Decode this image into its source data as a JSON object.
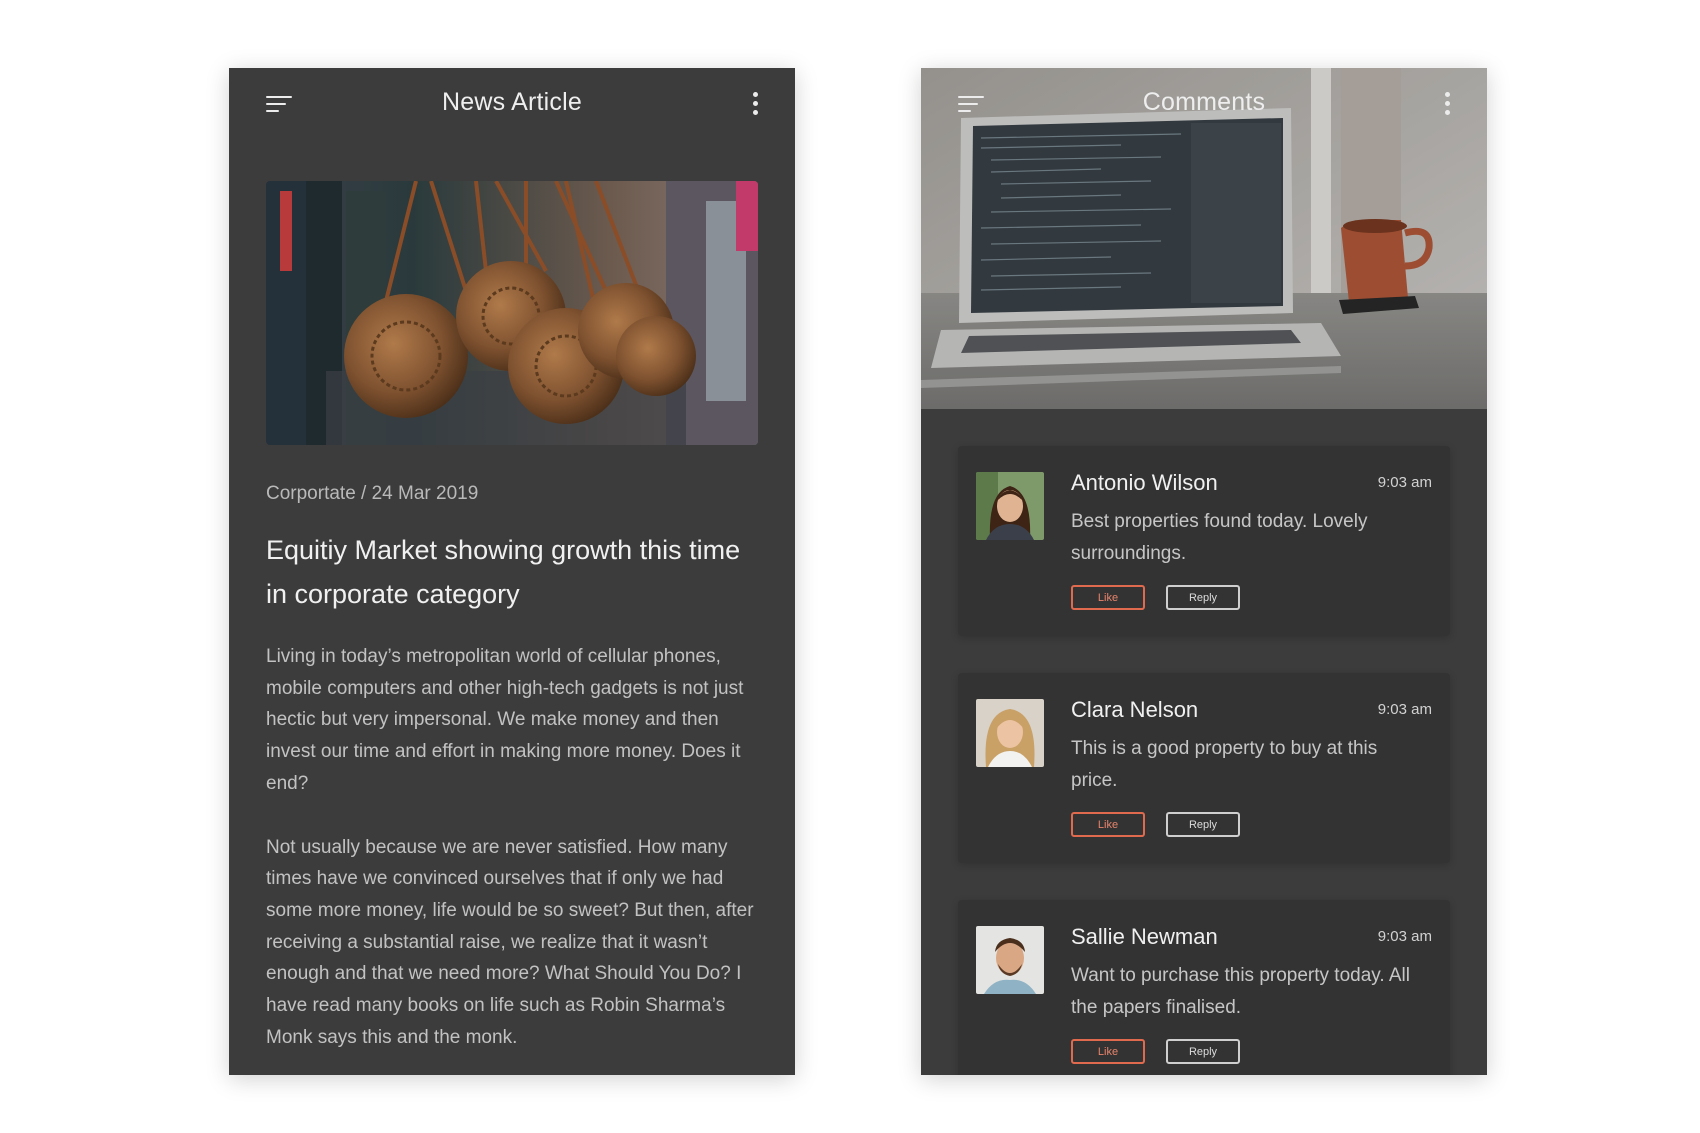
{
  "article_screen": {
    "header": {
      "title": "News Article",
      "menu_icon": "hamburger-menu-icon",
      "more_icon": "kebab-more-icon"
    },
    "hero_image": "photo-woven-rattan-bags",
    "meta": "Corportate / 24 Mar 2019",
    "title": "Equitiy Market showing growth this time in corporate category",
    "paragraphs": [
      "Living in today’s metropolitan world of cellular phones, mobile computers and other high-tech gadgets is not just hectic but very impersonal. We make money and then invest our time and effort in making more money. Does it end?",
      "Not usually because we are never satisfied. How many times have we convinced ourselves that if only we had some more money, life would be so sweet? But then, after receiving a substantial raise, we realize that it wasn’t enough and that we need more? What Should You Do? I have read many books on life such as Robin Sharma’s Monk says this and the monk."
    ]
  },
  "comments_screen": {
    "header": {
      "title": "Comments",
      "menu_icon": "hamburger-menu-icon",
      "more_icon": "kebab-more-icon"
    },
    "cover_image": "photo-laptop-and-coffee-mug",
    "comments": [
      {
        "name": "Antonio Wilson",
        "time": "9:03 am",
        "text": "Best properties found today. Lovely surroundings.",
        "like_label": "Like",
        "reply_label": "Reply"
      },
      {
        "name": "Clara Nelson",
        "time": "9:03 am",
        "text": "This is a good property to buy at this price.",
        "like_label": "Like",
        "reply_label": "Reply"
      },
      {
        "name": "Sallie Newman",
        "time": "9:03 am",
        "text": "Want to purchase this property today. All the papers finalised.",
        "like_label": "Like",
        "reply_label": "Reply"
      }
    ]
  },
  "colors": {
    "page_background": "#ffffff",
    "screen_background": "#3c3c3c",
    "card_background": "#333333",
    "accent_like": "#e06a4e",
    "reply_border": "#cfcfcf"
  }
}
